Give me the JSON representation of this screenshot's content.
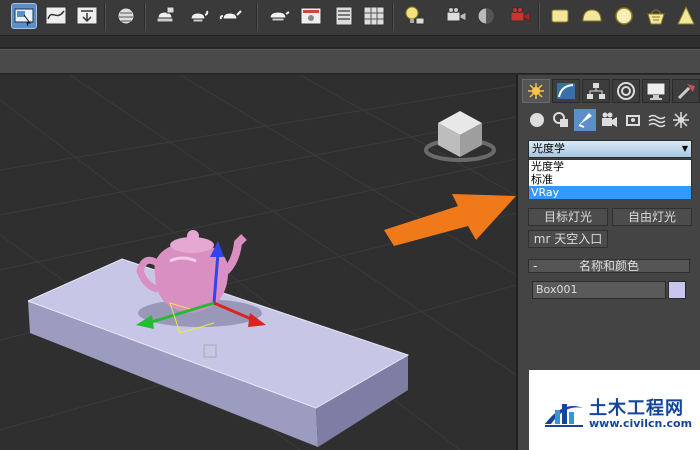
{
  "toolbar": {
    "icons": [
      "select-object-icon",
      "curve-editor-icon",
      "dope-sheet-icon",
      "material-editor-icon",
      "render-setup-icon",
      "rendered-frame-icon",
      "render-icon",
      "teapot-icon",
      "render-production-icon",
      "layer-icon",
      "layer-list-icon",
      "light-bulb-icon",
      "camera-icon",
      "sphere-icon",
      "camera-record-icon",
      "box-icon",
      "dome-icon",
      "sphere-light-icon",
      "basket-icon",
      "cone-icon"
    ]
  },
  "panel": {
    "tabs": [
      "create-tab",
      "modify-tab",
      "hierarchy-tab",
      "motion-tab",
      "display-tab",
      "utilities-tab"
    ],
    "category_icons": [
      "geometry-icon",
      "shapes-icon",
      "lights-icon",
      "cameras-icon",
      "helpers-icon",
      "space-warps-icon",
      "systems-icon"
    ],
    "dropdown": {
      "selected": "光度学",
      "options": [
        "光度学",
        "标准",
        "VRay"
      ],
      "highlighted": "VRay"
    },
    "buttons": {
      "target_light": "目标灯光",
      "free_light": "自由灯光",
      "mr_sky_portal": "mr 天空入口"
    },
    "name_color_rollout": {
      "toggle": "-",
      "title": "名称和颜色",
      "name_value": "Box001",
      "swatch_color": "#c9c6ee"
    }
  },
  "viewport": {
    "objects": [
      "teapot",
      "box"
    ],
    "teapot_color": "#d98fc2",
    "box_color": "#c8c6e6"
  },
  "callout": {
    "arrow_color": "#f07a1a"
  },
  "watermark": {
    "name": "土木工程网",
    "url": "www.civilcn.com"
  }
}
